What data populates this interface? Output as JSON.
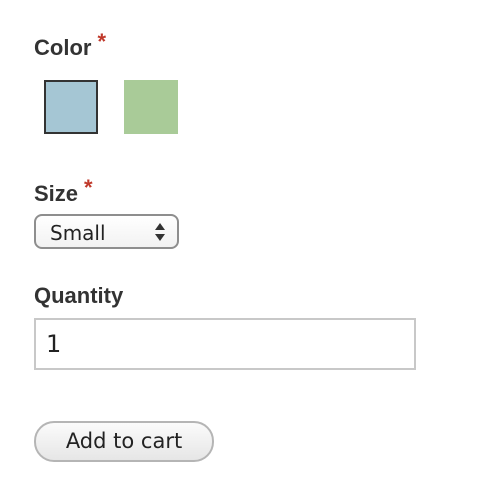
{
  "form": {
    "color": {
      "label": "Color",
      "required_mark": "*",
      "swatches": [
        {
          "name": "blue",
          "color": "#a5c6d4",
          "selected": true
        },
        {
          "name": "green",
          "color": "#a9cb98",
          "selected": false
        }
      ]
    },
    "size": {
      "label": "Size",
      "required_mark": "*",
      "selected_value": "Small",
      "icon": "updown-arrows-icon"
    },
    "quantity": {
      "label": "Quantity",
      "value": "1"
    },
    "add_to_cart_label": "Add to cart"
  },
  "colors": {
    "required": "#c0392b",
    "label_text": "#333333"
  }
}
